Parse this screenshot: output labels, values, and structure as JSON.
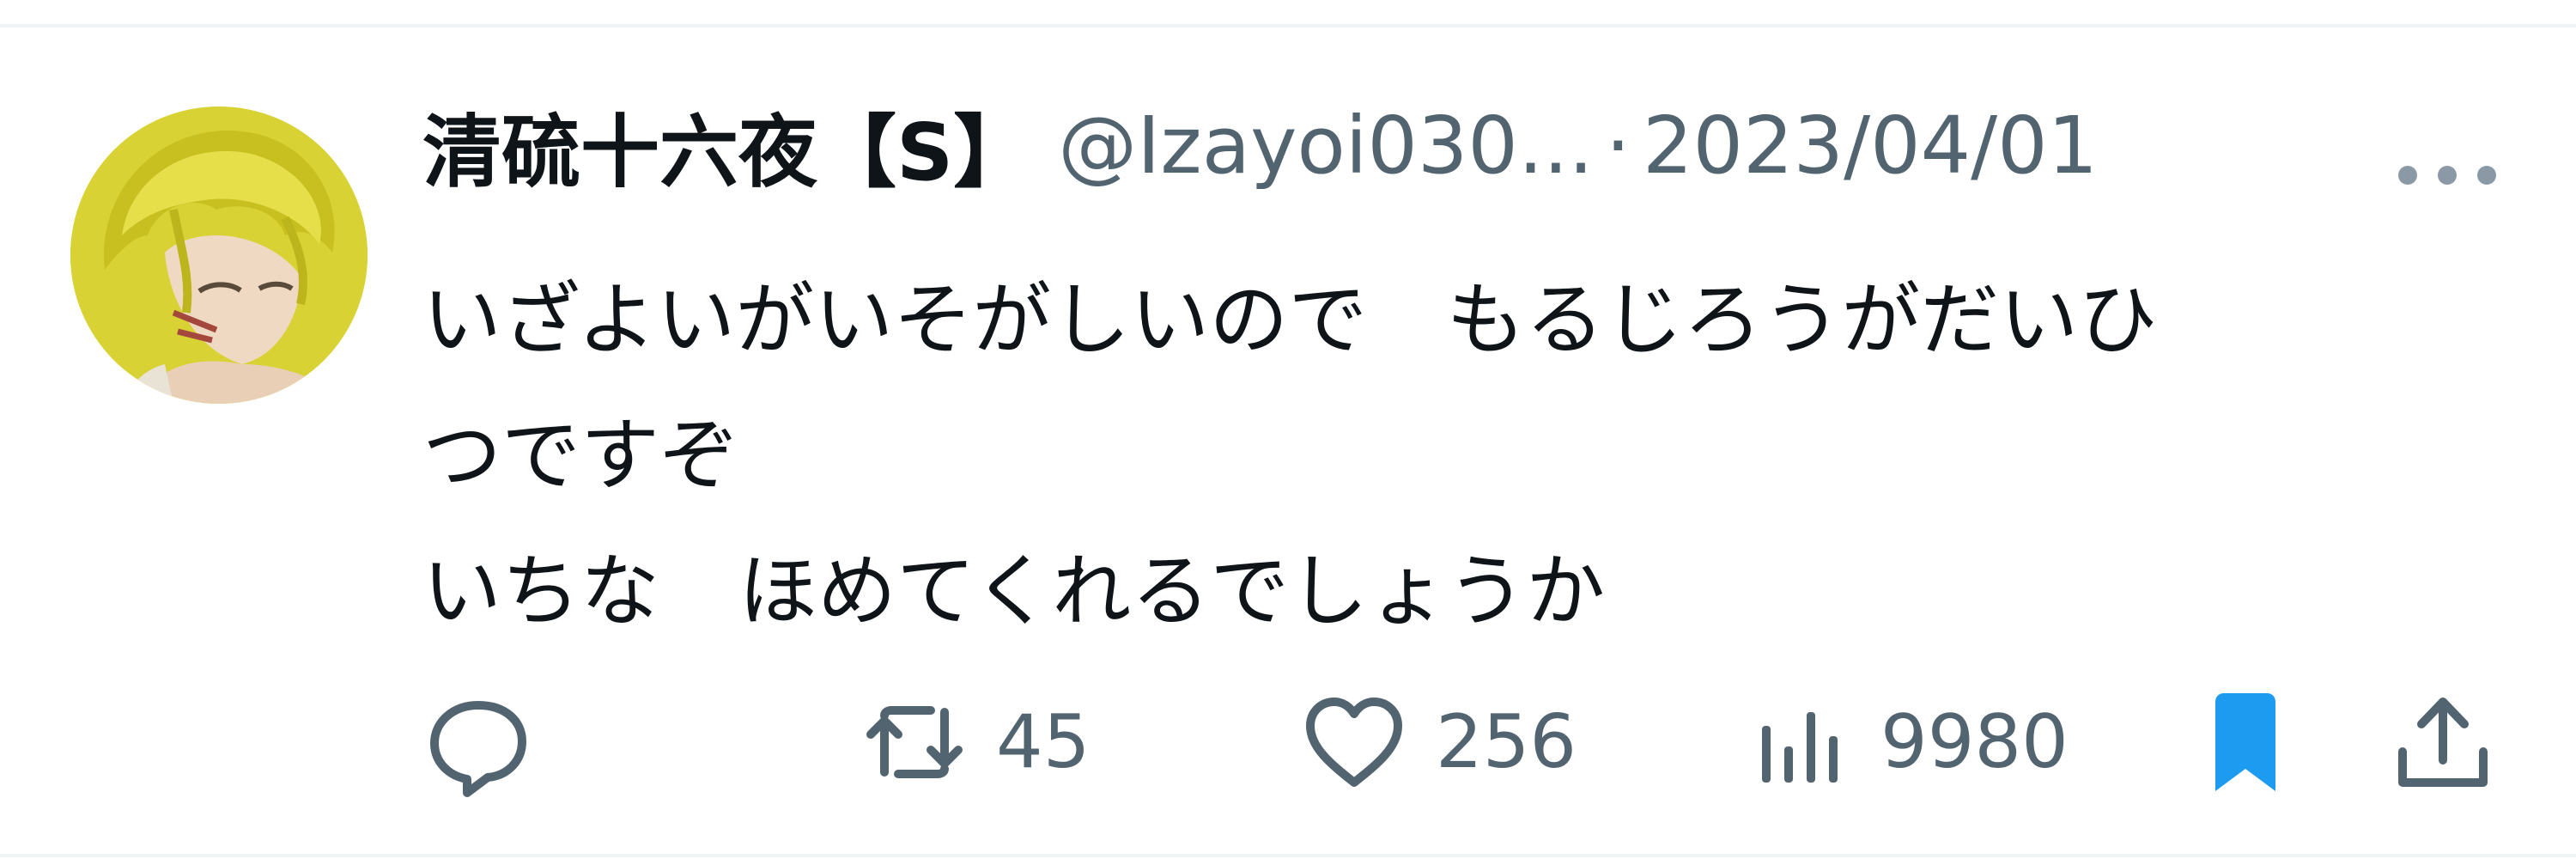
{
  "tweet": {
    "display_name": "清硫十六夜【S】",
    "handle": "@Izayoi030...",
    "separator": "·",
    "date": "2023/04/01",
    "body_lines": [
      "いざよいがいそがしいので　もるじろうがだいひ",
      "つですぞ",
      "いちな　ほめてくれるでしょうか"
    ]
  },
  "actions": {
    "reply_icon": "reply-bubble-icon",
    "retweet_icon": "retweet-icon",
    "retweet_count": "45",
    "like_icon": "heart-icon",
    "like_count": "256",
    "views_icon": "views-bar-chart-icon",
    "views_count": "9980",
    "bookmark_icon": "bookmark-filled-icon",
    "share_icon": "share-upload-icon"
  },
  "colors": {
    "text_primary": "#0f1419",
    "text_secondary": "#536471",
    "bookmark_accent": "#1d9bf0",
    "divider": "#eff3f4",
    "more_dots": "#8b98a5"
  }
}
